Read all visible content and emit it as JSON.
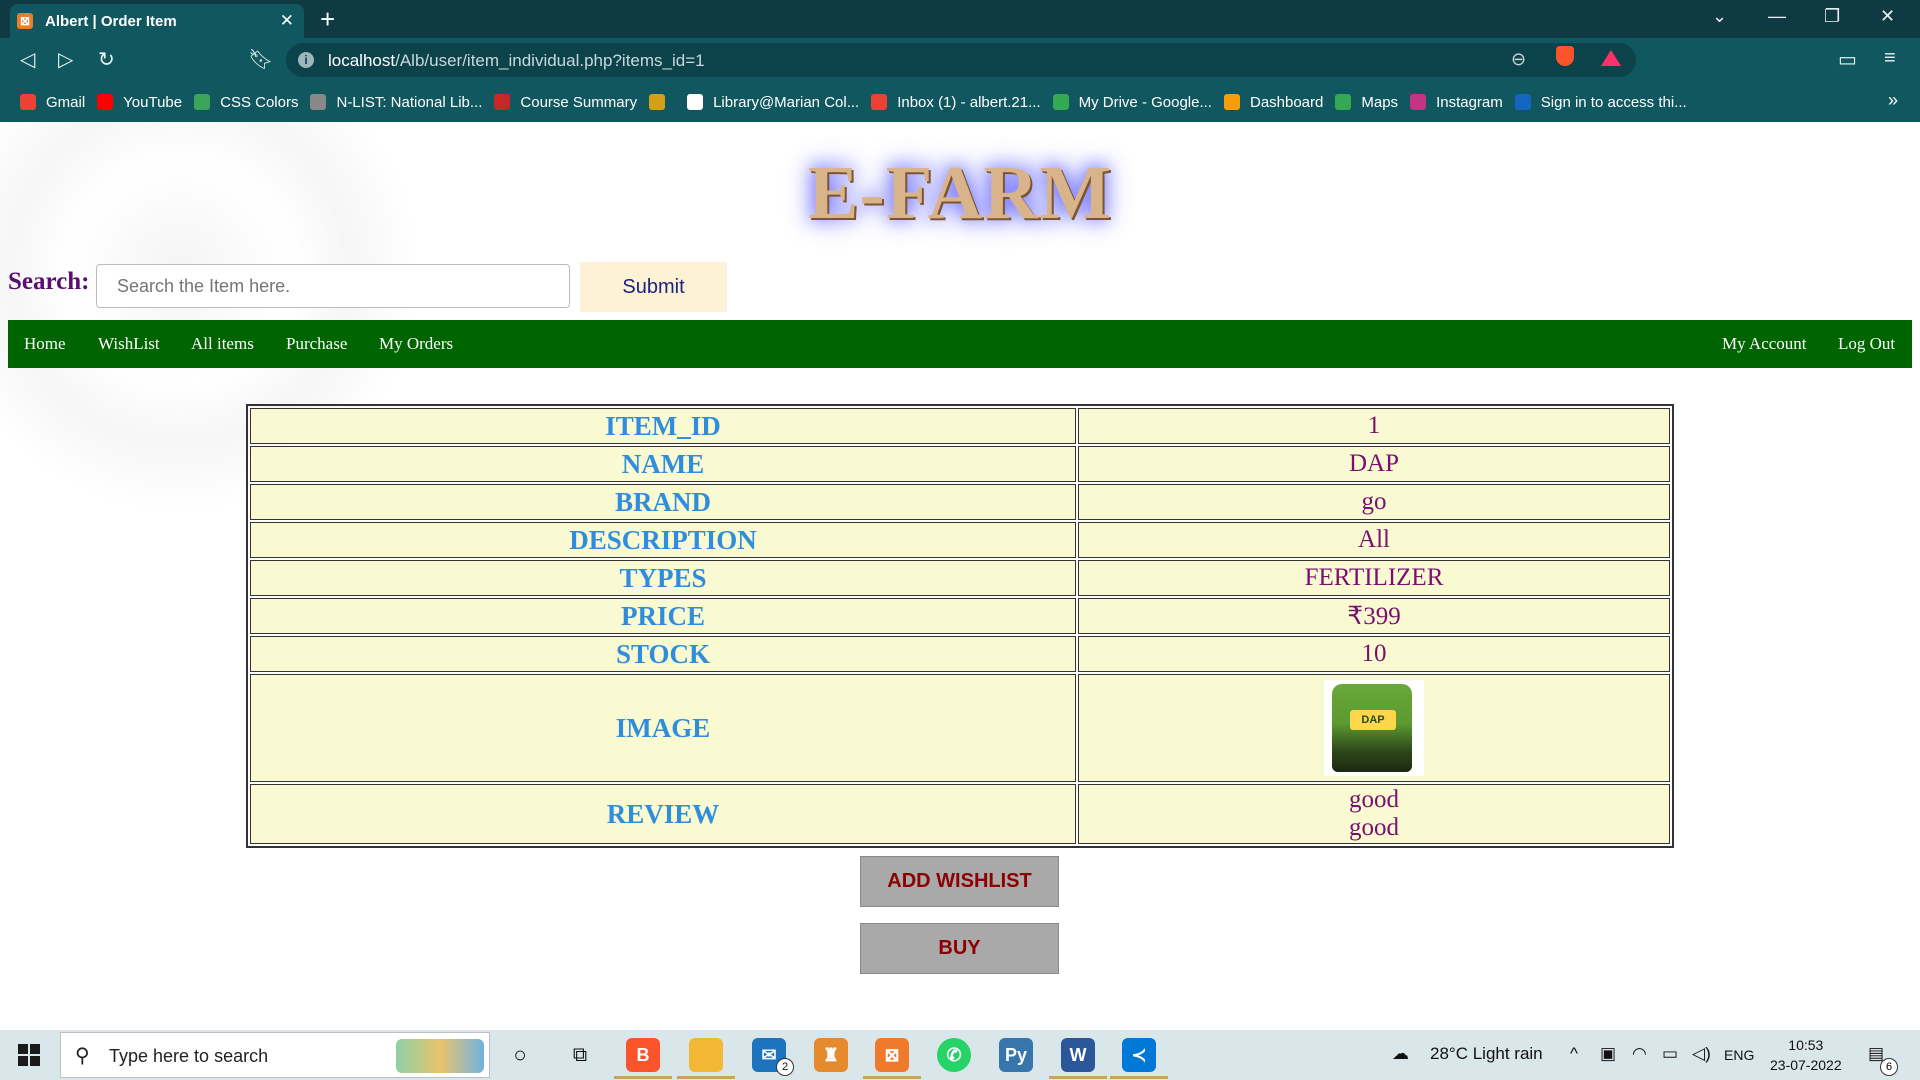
{
  "browser": {
    "tab_title": "Albert | Order Item",
    "tab_close": "✕",
    "new_tab": "+",
    "url_host": "localhost",
    "url_path": "/Alb/user/item_individual.php?items_id=1",
    "bookmarks": [
      {
        "label": "Gmail",
        "color": "#ea4335"
      },
      {
        "label": "YouTube",
        "color": "#ff0000"
      },
      {
        "label": "CSS Colors",
        "color": "#3ba55c"
      },
      {
        "label": "N-LIST: National Lib...",
        "color": "#888888"
      },
      {
        "label": "Course Summary",
        "color": "#c62828"
      },
      {
        "label": "",
        "color": "#d4a017"
      },
      {
        "label": "Library@Marian Col...",
        "color": "#ffffff"
      },
      {
        "label": "Inbox (1) - albert.21...",
        "color": "#ea4335"
      },
      {
        "label": "My Drive - Google...",
        "color": "#34a853"
      },
      {
        "label": "Dashboard",
        "color": "#f59e0b"
      },
      {
        "label": "Maps",
        "color": "#34a853"
      },
      {
        "label": "Instagram",
        "color": "#c13584"
      },
      {
        "label": "Sign in to access thi...",
        "color": "#1565c0"
      }
    ],
    "bookmarks_more": "»"
  },
  "site": {
    "logo": "E-FARM",
    "search_label": "Search:",
    "search_placeholder": "Search the Item here.",
    "submit_label": "Submit",
    "nav_left": [
      "Home",
      "WishList",
      "All items",
      "Purchase",
      "My Orders"
    ],
    "nav_right": [
      "My Account",
      "Log Out"
    ]
  },
  "item": {
    "rows": [
      {
        "key": "ITEM_ID",
        "value": "1"
      },
      {
        "key": "NAME",
        "value": "DAP"
      },
      {
        "key": "BRAND",
        "value": "go"
      },
      {
        "key": "DESCRIPTION",
        "value": "All"
      },
      {
        "key": "TYPES",
        "value": "FERTILIZER"
      },
      {
        "key": "PRICE",
        "value": "₹399"
      },
      {
        "key": "STOCK",
        "value": "10"
      }
    ],
    "image_key": "IMAGE",
    "image_label": "DAP",
    "review_key": "REVIEW",
    "reviews": [
      "good",
      "good"
    ]
  },
  "actions": {
    "wishlist": "ADD WISHLIST",
    "buy": "BUY"
  },
  "taskbar": {
    "search_placeholder": "Type here to search",
    "weather": "28°C  Light rain",
    "language": "ENG",
    "time": "10:53",
    "date": "23-07-2022",
    "mail_badge": "2",
    "notif_badge": "6"
  },
  "colors": {
    "nav_bg": "#006400",
    "table_bg": "#fafad2",
    "key_color": "#2f8ddc",
    "value_color": "#7a0f6e",
    "button_text": "#8b0000"
  }
}
